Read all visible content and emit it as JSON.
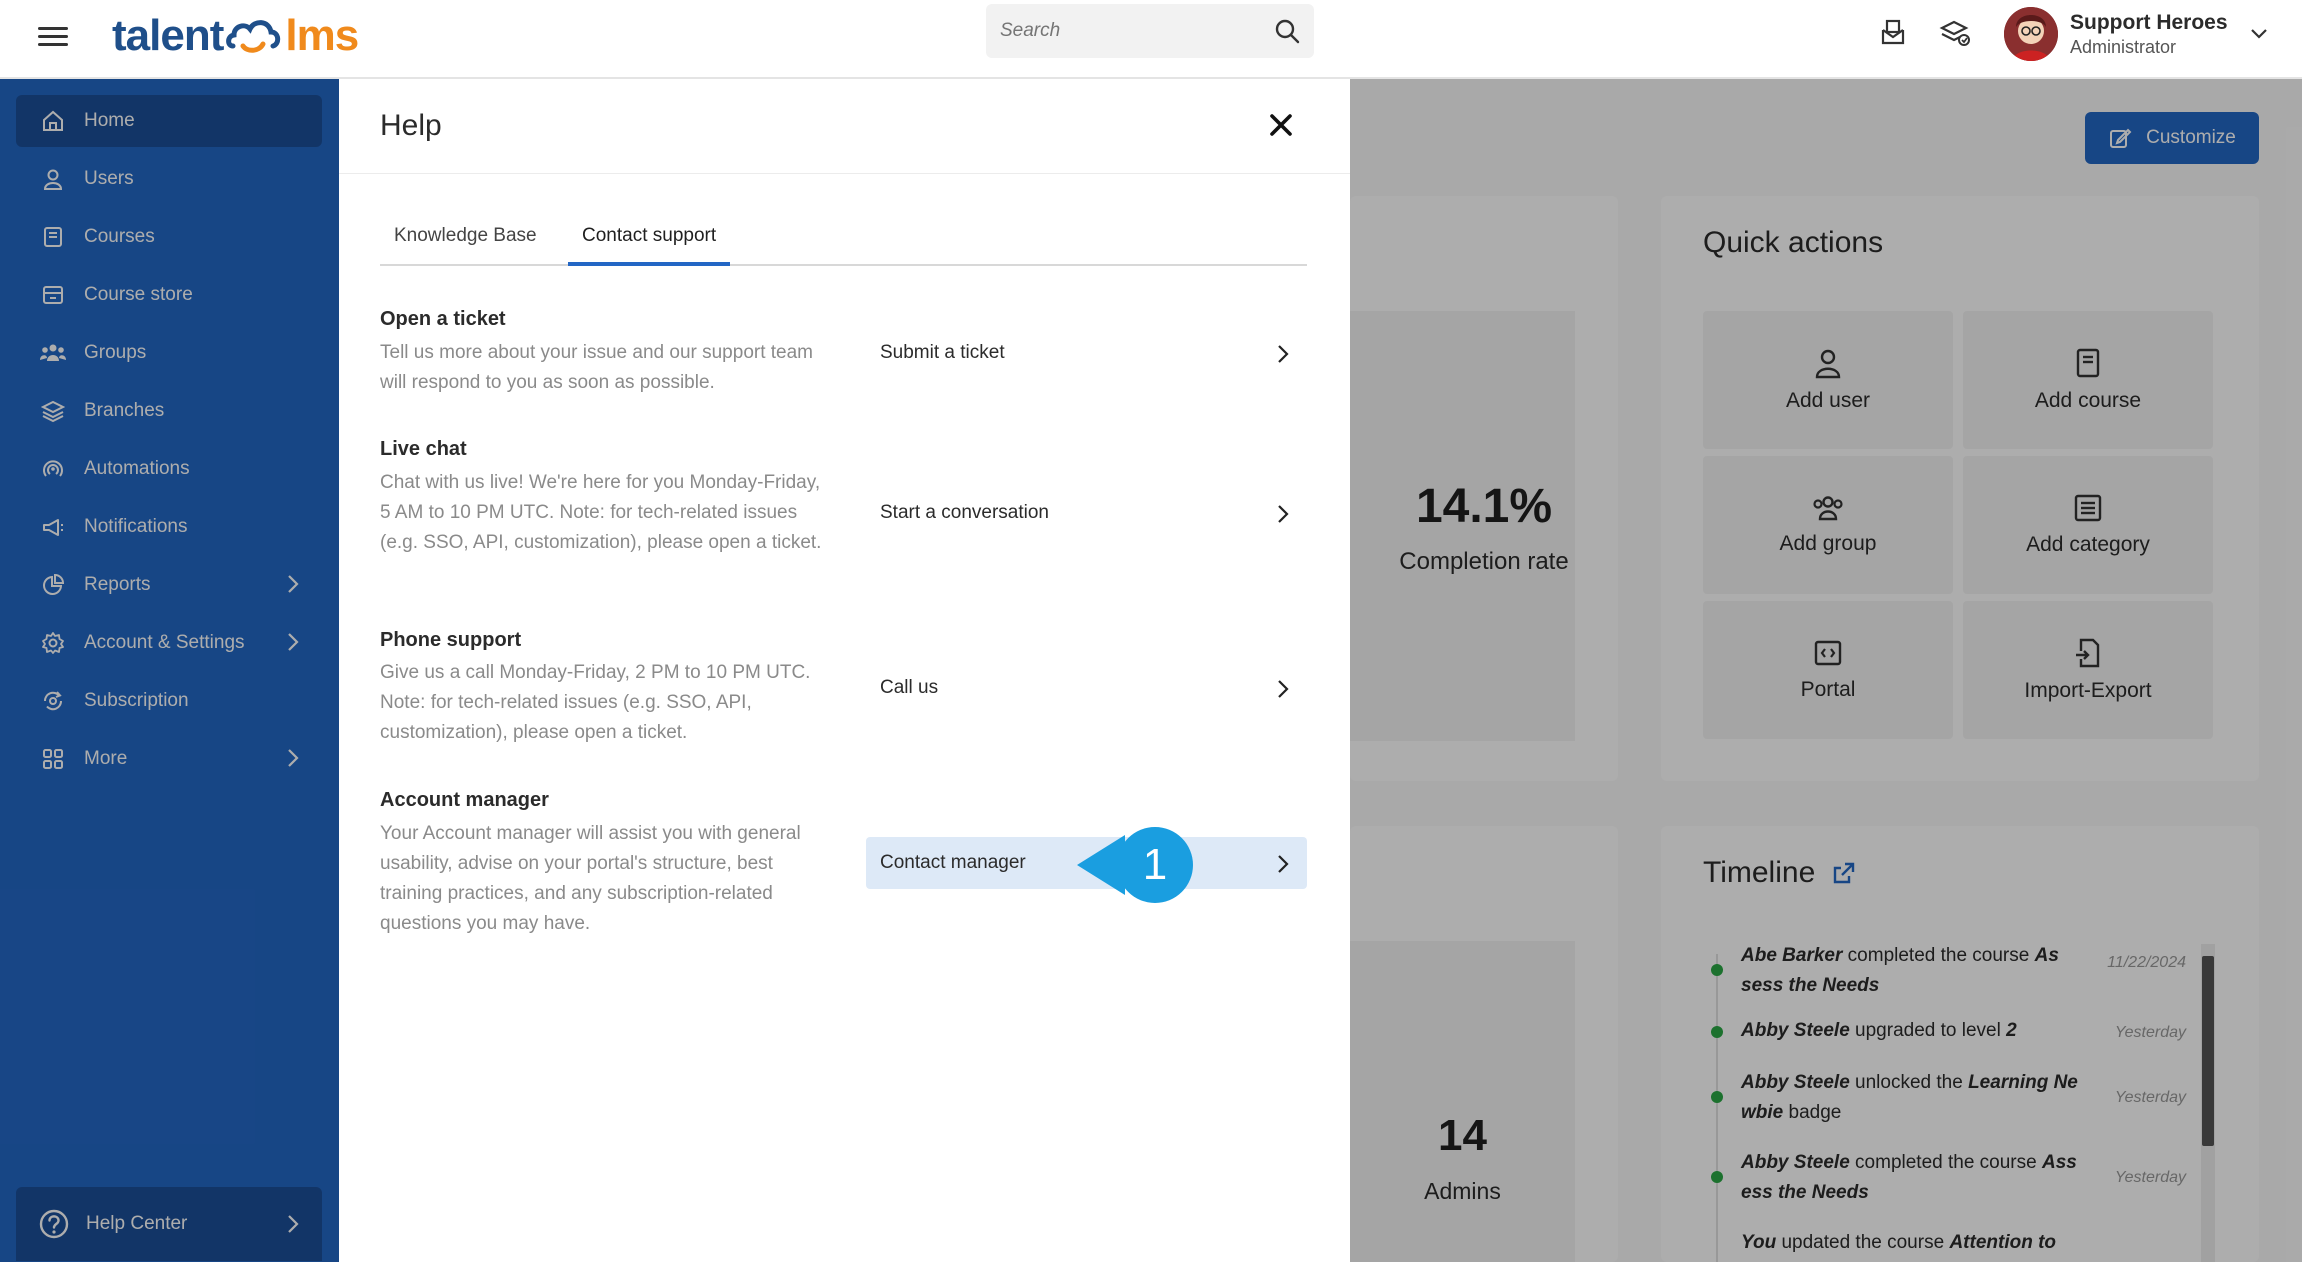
{
  "topbar": {
    "logo_part1": "talent",
    "logo_part2": "lms",
    "search_placeholder": "Search",
    "user_name": "Support Heroes",
    "user_role": "Administrator"
  },
  "sidebar": {
    "items": [
      {
        "label": "Home",
        "icon": "home-icon"
      },
      {
        "label": "Users",
        "icon": "user-icon"
      },
      {
        "label": "Courses",
        "icon": "book-icon"
      },
      {
        "label": "Course store",
        "icon": "store-icon"
      },
      {
        "label": "Groups",
        "icon": "groups-icon"
      },
      {
        "label": "Branches",
        "icon": "layers-icon"
      },
      {
        "label": "Automations",
        "icon": "automation-icon"
      },
      {
        "label": "Notifications",
        "icon": "megaphone-icon"
      },
      {
        "label": "Reports",
        "icon": "pie-chart-icon"
      },
      {
        "label": "Account & Settings",
        "icon": "gear-icon"
      },
      {
        "label": "Subscription",
        "icon": "subscription-icon"
      },
      {
        "label": "More",
        "icon": "grid-icon"
      }
    ],
    "help_center": "Help Center"
  },
  "background": {
    "customize": "Customize",
    "quick_actions_title": "Quick actions",
    "quick_actions": [
      "Add user",
      "Add course",
      "Add group",
      "Add category",
      "Portal",
      "Import-Export"
    ],
    "completion_value": "14.1%",
    "completion_label": "Completion rate",
    "admins_value": "14",
    "admins_label": "Admins",
    "timeline_title": "Timeline",
    "timeline": [
      {
        "who": "Abe Barker",
        "text": " completed the course ",
        "what": "As sess the Needs",
        "when": "11/22/2024"
      },
      {
        "who": "Abby Steele",
        "text": " upgraded to level ",
        "what": "2",
        "when": "Yesterday"
      },
      {
        "who": "Abby Steele",
        "text": " unlocked the ",
        "what": "Learning Ne wbie",
        "tail": " badge",
        "when": "Yesterday"
      },
      {
        "who": "Abby Steele",
        "text": " completed the course ",
        "what": "Ass ess the Needs",
        "when": "Yesterday"
      },
      {
        "who": "You",
        "text": " updated the course ",
        "what": "Attention to",
        "when": ""
      }
    ]
  },
  "help": {
    "title": "Help",
    "tabs": [
      "Knowledge Base",
      "Contact support"
    ],
    "sections": [
      {
        "title": "Open a ticket",
        "desc": "Tell us more about your issue and our support team will respond to you as soon as possible.",
        "action": "Submit a ticket"
      },
      {
        "title": "Live chat",
        "desc": "Chat with us live! We're here for you Monday-Friday, 5 AM to 10 PM UTC. Note: for tech-related issues (e.g. SSO, API, customization), please open a ticket.",
        "action": "Start a conversation"
      },
      {
        "title": "Phone support",
        "desc": "Give us a call Monday-Friday, 2 PM to 10 PM UTC. Note: for tech-related issues (e.g. SSO, API, customization), please open a ticket.",
        "action": "Call us"
      },
      {
        "title": "Account manager",
        "desc": "Your Account manager will assist you with general usability, advise on your portal's structure, best training practices, and any subscription-related questions you may have.",
        "action": "Contact manager"
      }
    ]
  },
  "callout": {
    "number": "1",
    "color": "#1a9ee0"
  }
}
